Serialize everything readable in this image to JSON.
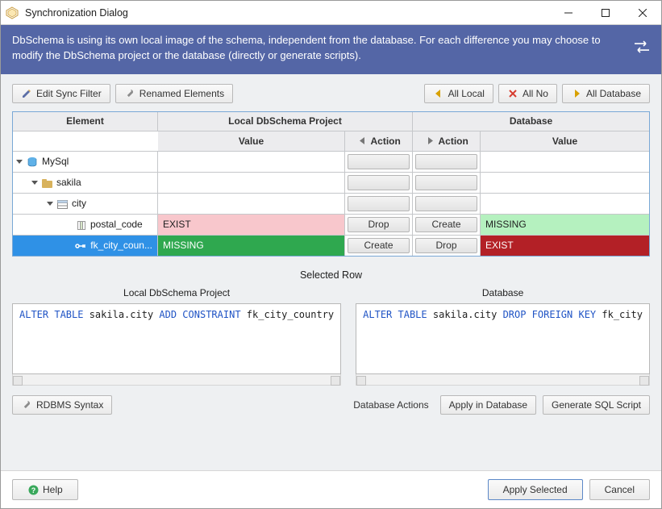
{
  "title": "Synchronization Dialog",
  "banner": {
    "text": "DbSchema is using its own local image of the schema, independent from the database. For each difference you may choose to modify the DbSchema project or the database (directly or generate scripts)."
  },
  "toolbar": {
    "edit_sync_filter": "Edit Sync Filter",
    "renamed_elements": "Renamed Elements",
    "all_local": "All Local",
    "all_no": "All No",
    "all_database": "All Database"
  },
  "grid": {
    "headers": {
      "element": "Element",
      "local_project": "Local DbSchema Project",
      "database": "Database",
      "value": "Value",
      "action_l": "Action",
      "action_r": "Action"
    },
    "rows": [
      {
        "tree": "MySql",
        "depth": 0,
        "kind": "db",
        "lval": "",
        "lact": "",
        "ract": "",
        "rval": "",
        "selected": false
      },
      {
        "tree": "sakila",
        "depth": 1,
        "kind": "schema",
        "lval": "",
        "lact": "",
        "ract": "",
        "rval": "",
        "selected": false
      },
      {
        "tree": "city",
        "depth": 2,
        "kind": "table",
        "lval": "",
        "lact": "",
        "ract": "",
        "rval": "",
        "selected": false
      },
      {
        "tree": "postal_code",
        "depth": 3,
        "kind": "col",
        "lval": "EXIST",
        "lact": "Drop",
        "ract": "Create",
        "rval": "MISSING",
        "selected": false,
        "lval_cls": "pink",
        "rval_cls": "lgreen"
      },
      {
        "tree": "fk_city_coun...",
        "depth": 3,
        "kind": "fk",
        "lval": "MISSING",
        "lact": "Create",
        "ract": "Drop",
        "rval": "EXIST",
        "selected": true,
        "lval_cls": "green",
        "rval_cls": "red"
      }
    ]
  },
  "selected_row": {
    "title": "Selected Row",
    "local_hd": "Local DbSchema Project",
    "db_hd": "Database",
    "local_sql": {
      "pre": "ALTER TABLE",
      "mid": " sakila.city ",
      "kw2": "ADD CONSTRAINT",
      "tail": " fk_city_country"
    },
    "db_sql": {
      "pre": "ALTER TABLE",
      "mid": " sakila.city ",
      "kw2": "DROP FOREIGN KEY",
      "tail": " fk_city"
    }
  },
  "bar2": {
    "rdbms_syntax": "RDBMS Syntax",
    "db_actions": "Database Actions",
    "apply_in_db": "Apply in Database",
    "generate_sql": "Generate SQL Script"
  },
  "footer": {
    "help": "Help",
    "apply_selected": "Apply Selected",
    "cancel": "Cancel"
  }
}
